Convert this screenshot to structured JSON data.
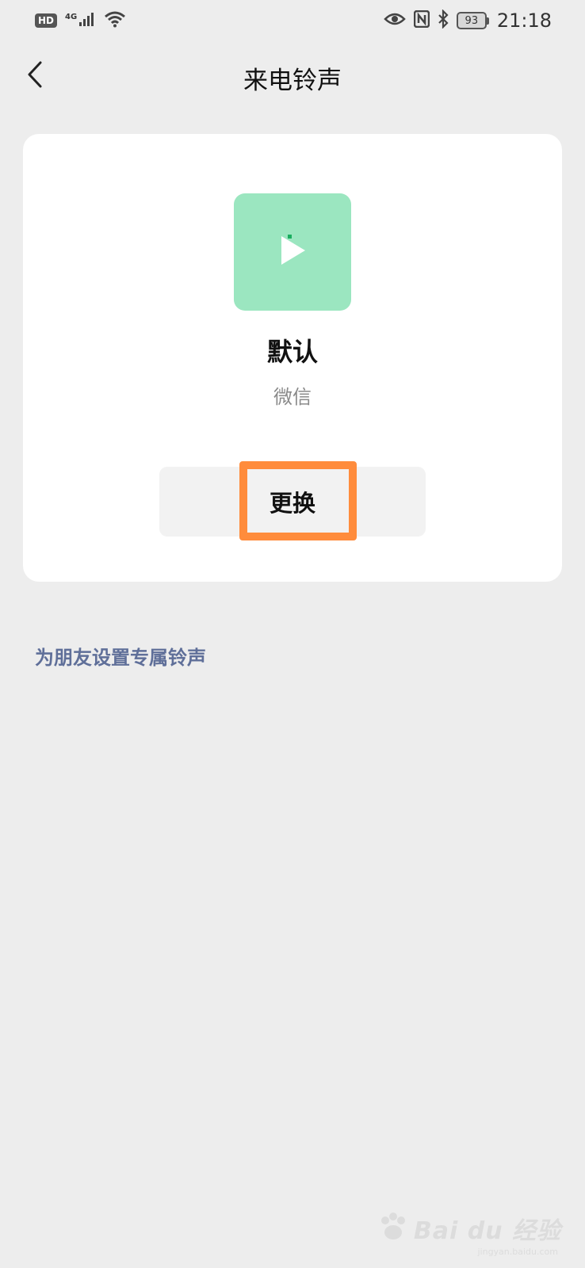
{
  "status_bar": {
    "hd_label": "HD",
    "network_label": "4G",
    "battery_level": "93",
    "time": "21:18",
    "icons": [
      "signal-icon",
      "wifi-icon",
      "eye-icon",
      "nfc-icon",
      "bluetooth-icon",
      "battery-icon"
    ]
  },
  "header": {
    "title": "来电铃声",
    "back_icon": "chevron-left-icon"
  },
  "ringtone_card": {
    "name": "默认",
    "source": "微信",
    "play_icon": "play-icon",
    "change_label": "更换",
    "thumbnail_color": "#9be6c0"
  },
  "friend_ringtone_link": "为朋友设置专属铃声",
  "annotation": {
    "highlight_color": "#ff8c3c"
  },
  "watermark": {
    "text": "Bai du 经验",
    "sub": "jingyan.baidu.com"
  }
}
